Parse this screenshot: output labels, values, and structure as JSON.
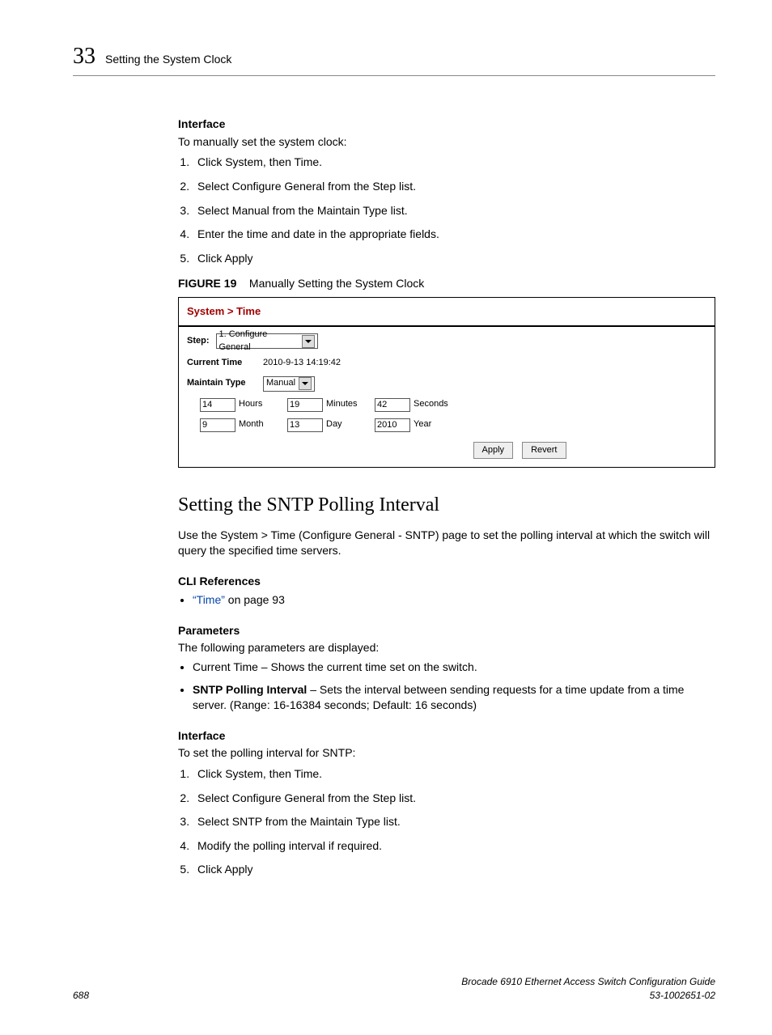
{
  "header": {
    "chapter_num": "33",
    "chapter_title": "Setting the System Clock"
  },
  "sec1": {
    "heading": "Interface",
    "intro": "To manually set the system clock:",
    "steps": [
      "Click System, then Time.",
      "Select Configure General from the Step list.",
      "Select Manual from the Maintain Type list.",
      "Enter the time and date in the appropriate fields.",
      "Click Apply"
    ]
  },
  "figure": {
    "label": "FIGURE 19",
    "caption": "Manually Setting the System Clock"
  },
  "screenshot": {
    "breadcrumb": "System > Time",
    "step_label": "Step:",
    "step_value": "1. Configure General",
    "current_time_label": "Current Time",
    "current_time_value": "2010-9-13 14:19:42",
    "maintain_type_label": "Maintain Type",
    "maintain_type_value": "Manual",
    "hours_value": "14",
    "hours_label": "Hours",
    "minutes_value": "19",
    "minutes_label": "Minutes",
    "seconds_value": "42",
    "seconds_label": "Seconds",
    "month_value": "9",
    "month_label": "Month",
    "day_value": "13",
    "day_label": "Day",
    "year_value": "2010",
    "year_label": "Year",
    "apply": "Apply",
    "revert": "Revert"
  },
  "h2": "Setting the SNTP Polling Interval",
  "h2_intro": "Use the System > Time (Configure General - SNTP) page to set the polling interval at which the switch will query the specified time servers.",
  "cli": {
    "heading": "CLI References",
    "link_text": "“Time”",
    "link_suffix": " on page 93"
  },
  "params": {
    "heading": "Parameters",
    "intro": "The following parameters are displayed:",
    "items": [
      {
        "bold": "",
        "text": "Current Time – Shows the current time set on the switch."
      },
      {
        "bold": "SNTP Polling Interval",
        "text": " – Sets the interval between sending requests for a time update from a time server. (Range: 16-16384 seconds; Default: 16 seconds)"
      }
    ]
  },
  "sec2": {
    "heading": "Interface",
    "intro": "To set the polling interval for SNTP:",
    "steps": [
      "Click System, then Time.",
      "Select Configure General from the Step list.",
      "Select SNTP from the Maintain Type list.",
      "Modify the polling interval if required.",
      "Click Apply"
    ]
  },
  "footer": {
    "page": "688",
    "book": "Brocade 6910 Ethernet Access Switch Configuration Guide",
    "doc": "53-1002651-02"
  }
}
